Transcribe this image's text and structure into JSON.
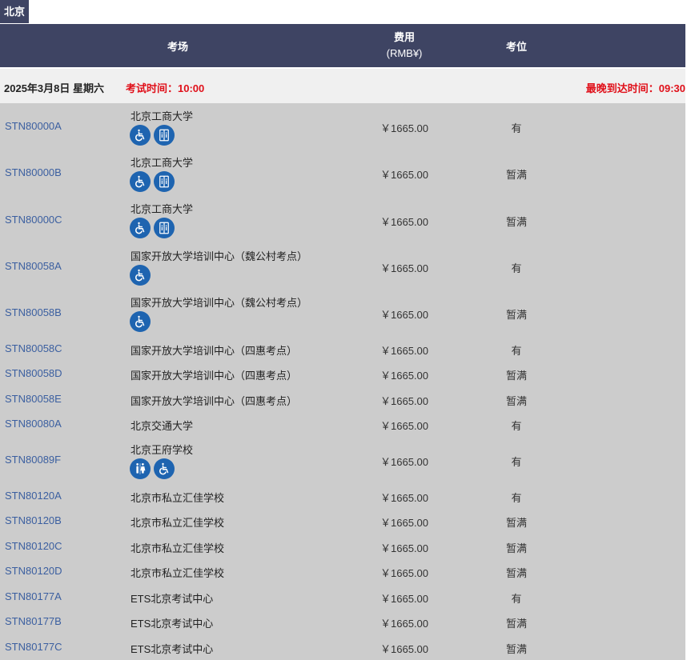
{
  "city_tab": "北京",
  "header": {
    "venue": "考场",
    "fee": "费用",
    "fee_unit": "(RMB¥)",
    "seat": "考位"
  },
  "session": {
    "date": "2025年3月8日 星期六",
    "exam_time": "考试时间：10:00",
    "latest_arrival": "最晚到达时间：09:30"
  },
  "rows": [
    {
      "code": "STN80000A",
      "venue": "北京工商大学",
      "fee": "￥1665.00",
      "seat": "有",
      "icons": [
        "wheelchair-icon",
        "elevator-icon"
      ]
    },
    {
      "code": "STN80000B",
      "venue": "北京工商大学",
      "fee": "￥1665.00",
      "seat": "暂满",
      "icons": [
        "wheelchair-icon",
        "elevator-icon"
      ]
    },
    {
      "code": "STN80000C",
      "venue": "北京工商大学",
      "fee": "￥1665.00",
      "seat": "暂满",
      "icons": [
        "wheelchair-icon",
        "elevator-icon"
      ]
    },
    {
      "code": "STN80058A",
      "venue": "国家开放大学培训中心（魏公村考点）",
      "fee": "￥1665.00",
      "seat": "有",
      "icons": [
        "wheelchair-icon"
      ]
    },
    {
      "code": "STN80058B",
      "venue": "国家开放大学培训中心（魏公村考点）",
      "fee": "￥1665.00",
      "seat": "暂满",
      "icons": [
        "wheelchair-icon"
      ]
    },
    {
      "code": "STN80058C",
      "venue": "国家开放大学培训中心（四惠考点）",
      "fee": "￥1665.00",
      "seat": "有",
      "icons": []
    },
    {
      "code": "STN80058D",
      "venue": "国家开放大学培训中心（四惠考点）",
      "fee": "￥1665.00",
      "seat": "暂满",
      "icons": []
    },
    {
      "code": "STN80058E",
      "venue": "国家开放大学培训中心（四惠考点）",
      "fee": "￥1665.00",
      "seat": "暂满",
      "icons": []
    },
    {
      "code": "STN80080A",
      "venue": "北京交通大学",
      "fee": "￥1665.00",
      "seat": "有",
      "icons": []
    },
    {
      "code": "STN80089F",
      "venue": "北京王府学校",
      "fee": "￥1665.00",
      "seat": "有",
      "icons": [
        "restroom-icon",
        "wheelchair-icon"
      ]
    },
    {
      "code": "STN80120A",
      "venue": "北京市私立汇佳学校",
      "fee": "￥1665.00",
      "seat": "有",
      "icons": []
    },
    {
      "code": "STN80120B",
      "venue": "北京市私立汇佳学校",
      "fee": "￥1665.00",
      "seat": "暂满",
      "icons": []
    },
    {
      "code": "STN80120C",
      "venue": "北京市私立汇佳学校",
      "fee": "￥1665.00",
      "seat": "暂满",
      "icons": []
    },
    {
      "code": "STN80120D",
      "venue": "北京市私立汇佳学校",
      "fee": "￥1665.00",
      "seat": "暂满",
      "icons": []
    },
    {
      "code": "STN80177A",
      "venue": "ETS北京考试中心",
      "fee": "￥1665.00",
      "seat": "有",
      "icons": []
    },
    {
      "code": "STN80177B",
      "venue": "ETS北京考试中心",
      "fee": "￥1665.00",
      "seat": "暂满",
      "icons": []
    },
    {
      "code": "STN80177C",
      "venue": "ETS北京考试中心",
      "fee": "￥1665.00",
      "seat": "暂满",
      "icons": []
    }
  ]
}
